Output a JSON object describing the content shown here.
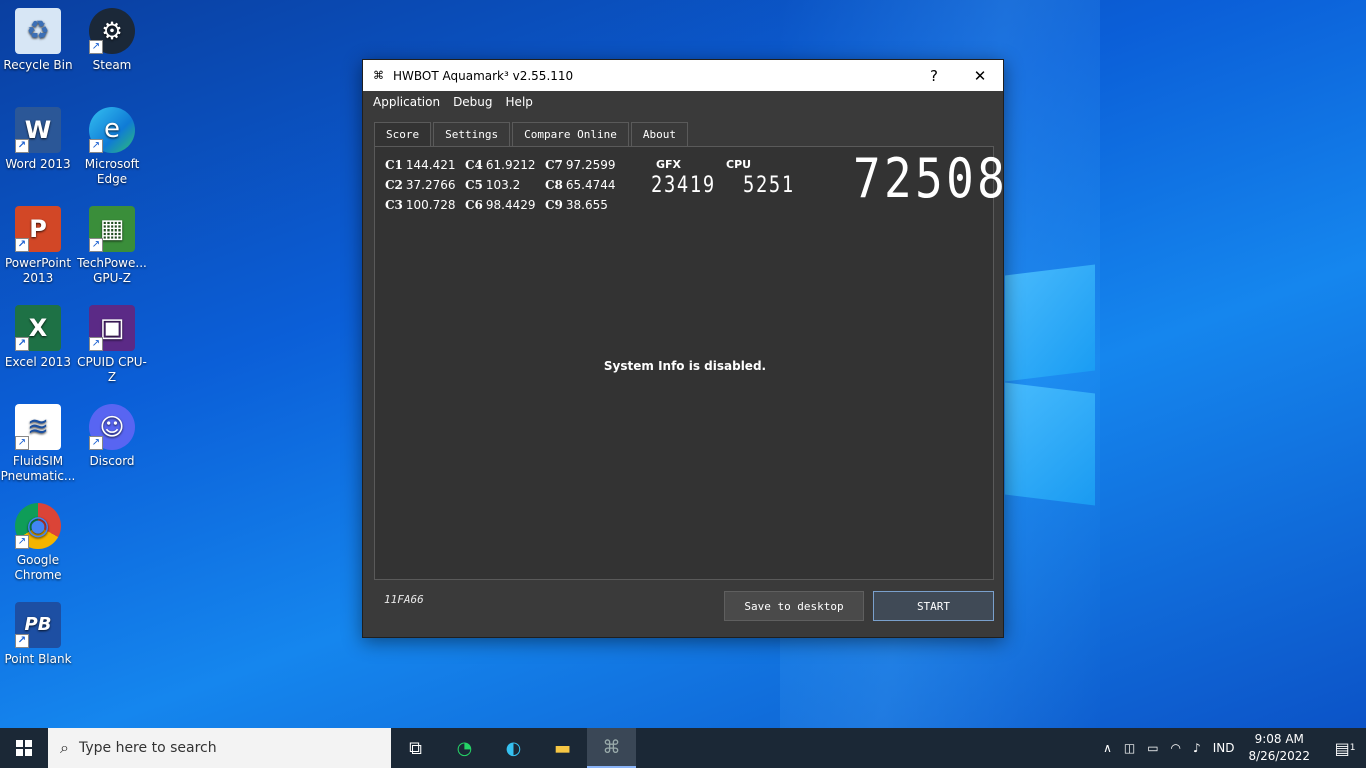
{
  "desktop": {
    "icons": [
      {
        "label": "Recycle Bin",
        "color": "#d7e6f5",
        "glyph": "♻"
      },
      {
        "label": "Steam",
        "color": "#1b2838",
        "glyph": "⚙"
      },
      {
        "label": "Word 2013",
        "color": "#2b5797",
        "glyph": "W"
      },
      {
        "label": "Microsoft Edge",
        "color": "#0f7bd6",
        "glyph": "e"
      },
      {
        "label": "PowerPoint 2013",
        "color": "#d24726",
        "glyph": "P"
      },
      {
        "label": "TechPowe... GPU-Z",
        "color": "#3a8e3a",
        "glyph": "▦"
      },
      {
        "label": "Excel 2013",
        "color": "#1e7145",
        "glyph": "X"
      },
      {
        "label": "CPUID CPU-Z",
        "color": "#5b2a86",
        "glyph": "▣"
      },
      {
        "label": "FluidSIM Pneumatic...",
        "color": "#ffffff",
        "glyph": "≋"
      },
      {
        "label": "Discord",
        "color": "#5865f2",
        "glyph": "☺"
      },
      {
        "label": "Google Chrome",
        "color": "#ffffff",
        "glyph": "◉"
      },
      {
        "label": "Point Blank",
        "color": "#1d4fa3",
        "glyph": "PB"
      }
    ]
  },
  "window": {
    "title": "HWBOT Aquamark³ v2.55.110",
    "help_button": "?",
    "close_button": "✕",
    "menu": [
      "Application",
      "Debug",
      "Help"
    ],
    "tabs": [
      "Score",
      "Settings",
      "Compare Online",
      "About"
    ],
    "scores": [
      {
        "label": "C1",
        "value": "144.421"
      },
      {
        "label": "C2",
        "value": "37.2766"
      },
      {
        "label": "C3",
        "value": "100.728"
      },
      {
        "label": "C4",
        "value": "61.9212"
      },
      {
        "label": "C5",
        "value": "103.2"
      },
      {
        "label": "C6",
        "value": "98.4429"
      },
      {
        "label": "C7",
        "value": "97.2599"
      },
      {
        "label": "C8",
        "value": "65.4744"
      },
      {
        "label": "C9",
        "value": "38.655"
      }
    ],
    "gfx_label": "GFX",
    "cpu_label": "CPU",
    "gfx_value": "23419",
    "cpu_value": "5251",
    "total_score": "72508",
    "system_info": "System Info is disabled.",
    "hash": "11FA66",
    "save_button": "Save to desktop",
    "start_button": "START"
  },
  "taskbar": {
    "search_placeholder": "Type here to search",
    "language": "IND",
    "time": "9:08 AM",
    "date": "8/26/2022",
    "notifications": "1"
  }
}
